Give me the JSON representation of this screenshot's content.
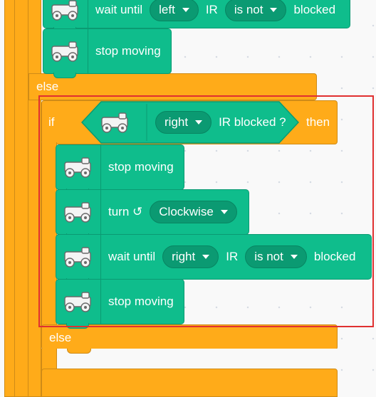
{
  "blocks": {
    "wait_top": {
      "label_wait": "wait until",
      "side": "left",
      "ir": "IR",
      "cond": "is not",
      "blocked": "blocked"
    },
    "stop1": "stop moving",
    "else_outer": "else",
    "if_kw": "if",
    "cond": {
      "side": "right",
      "label": "IR blocked ?"
    },
    "then_kw": "then",
    "stop2": "stop moving",
    "turn": {
      "label": "turn ↺",
      "direction": "Clockwise"
    },
    "wait_inner": {
      "label_wait": "wait until",
      "side": "right",
      "ir": "IR",
      "cond": "is not",
      "blocked": "blocked"
    },
    "stop3": "stop moving",
    "else_inner": "else"
  },
  "colors": {
    "motion": "#0fbd8c",
    "control": "#ffab19",
    "selection": "#e03030"
  }
}
